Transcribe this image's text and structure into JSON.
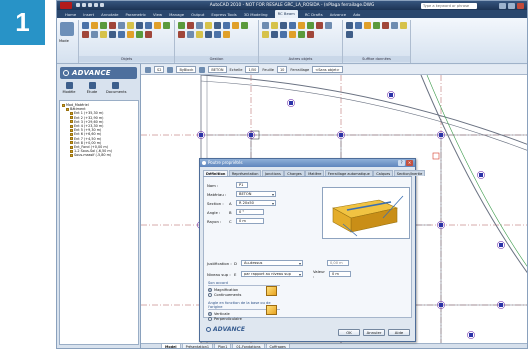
{
  "step_number": "1",
  "window": {
    "title": "AutoCAD 2010 - NOT FOR RESALE  GRC_LA_ROSIDA - (nPlaga ferrailage.DWG",
    "search_placeholder": "Type a keyword or phrase"
  },
  "menu": [
    "Home",
    "Insert",
    "Annotate",
    "Parametric",
    "View",
    "Manage",
    "Output",
    "Express Tools",
    "3D Modeling",
    "RC Beam",
    "RC Drafts",
    "Advance",
    "Ado"
  ],
  "menu_active_index": 9,
  "ribbon": {
    "big_button_label": "Mode",
    "panels": [
      "Objets",
      "Gestion",
      "Autres objets",
      "Suffixe données"
    ]
  },
  "toolstrip": {
    "layer": "S2",
    "style": "ByBlock",
    "section": "BETON",
    "scale": "Echelle",
    "scale_value": "1/50",
    "sheet": "Feuille",
    "sheet_value": "10",
    "mode": "Ferraillage",
    "mode_value": "<Sans objet>"
  },
  "sidebar": {
    "logo_text": "ADVANCE",
    "tabs": [
      "Modèle",
      "Étude",
      "Documents"
    ],
    "tree": [
      {
        "label": "Mod_Matériel",
        "level": 0
      },
      {
        "label": "Bâtiment",
        "level": 1
      },
      {
        "label": "Ent 1 (+35,30 m)",
        "level": 2
      },
      {
        "label": "Ent 2 (+32,90 m)",
        "level": 2
      },
      {
        "label": "Ent 3 (+29,60 m)",
        "level": 2
      },
      {
        "label": "Ent 4 (+23,30 m)",
        "level": 2
      },
      {
        "label": "Ent 5 (+9,30 m)",
        "level": 2
      },
      {
        "label": "Ent 6 (+6,60 m)",
        "level": 2
      },
      {
        "label": "Ent 7 (+4,50 m)",
        "level": 2
      },
      {
        "label": "Ent 8 (+0,00 m)",
        "level": 2
      },
      {
        "label": "Ent_Fond (+0,00 m)",
        "level": 2
      },
      {
        "label": "1-2 Sous-Sol (-6,50 m)",
        "level": 2
      },
      {
        "label": "Sous-massif (-5,80 m)",
        "level": 2
      }
    ]
  },
  "layout_tabs": [
    "Model",
    "Présentation1",
    "Plan1",
    "01-Fondations",
    "Coffrages"
  ],
  "layout_active_index": 0,
  "dialog": {
    "title": "Poutre propriétés",
    "tabs": [
      "Définition",
      "Représentation",
      "Jonctions",
      "Charges",
      "Matière",
      "Ferraillage automatique",
      "Calques",
      "Section/Inertie"
    ],
    "active_tab_index": 0,
    "fields": {
      "nom_label": "Nom :",
      "nom_value": "P1",
      "materiau_label": "Matériau :",
      "materiau_value": "BETON",
      "section_label": "Section :",
      "section_key": "A",
      "section_value": "R 20x50",
      "angle_label": "Angle :",
      "angle_key": "B",
      "angle_value": "0 °",
      "rayon_label": "Rayon :",
      "rayon_key": "C",
      "rayon_value": "0 m",
      "justif_label": "Justification :",
      "justif_key": "D",
      "justif_value": "Au-dessus",
      "justif_offset": "0,00 m",
      "niveau_label": "Niveau sup :",
      "niveau_key": "E",
      "niveau_value": "par rapport au niveau sup",
      "valeur_label": "Valeur :",
      "valeur_value": "0 m"
    },
    "group1": {
      "title": "Son accord",
      "options": [
        "Magnification",
        "Continuements"
      ],
      "selected": 0
    },
    "group2": {
      "title": "Angle en fonction de la base ou de l'origine",
      "options": [
        "Verticale",
        "Perpendiculaire"
      ],
      "selected": 0
    },
    "logo_text": "ADVANCE",
    "buttons": [
      "OK",
      "Annuler",
      "Aide"
    ]
  },
  "colors": {
    "step_badge": "#2893c7",
    "drawing_lines": "#6a7282",
    "grid_lines": "#9b2b2b",
    "columns": "#2b33a8"
  }
}
